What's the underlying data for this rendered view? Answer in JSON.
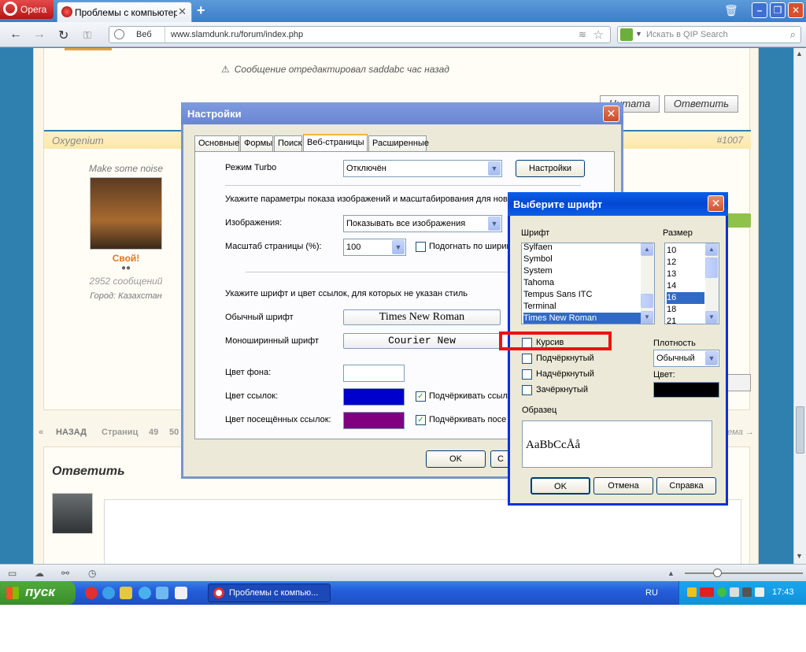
{
  "browser": {
    "menu_label": "Opera",
    "tab_title": "Проблемы с компьютер...",
    "tab_close": "✕",
    "new_tab": "+",
    "web_label": "Веб",
    "url": "www.slamdunk.ru/forum/index.php",
    "search_placeholder": "Искать в QIP Search"
  },
  "forum": {
    "edited_note": "Сообщение отредактировал saddabc час назад",
    "quote_button": "Цитата",
    "reply_button": "Ответить",
    "post_username": "Oxygenium",
    "post_number": "#1007",
    "user_motto": "Make some noise",
    "user_rank": "Свой!",
    "user_posts": "2952 сообщений",
    "user_city": "Город: Казахстан",
    "pager": {
      "prev": "«",
      "back": "НАЗАД",
      "pages_label": "Страниц",
      "page_a": "49",
      "page_b": "50",
      "next_topic": "тема →"
    },
    "reply_title": "Ответить"
  },
  "settings_dialog": {
    "title": "Настройки",
    "tabs": [
      "Основные",
      "Формы",
      "Поиск",
      "Веб-страницы",
      "Расширенные"
    ],
    "active_tab": "Веб-страницы",
    "turbo_label": "Режим Turbo",
    "turbo_value": "Отключён",
    "turbo_button": "Настройки",
    "images_hint": "Укажите параметры показа изображений и масштабирования для нов",
    "images_label": "Изображения:",
    "images_value": "Показывать все изображения",
    "zoom_label": "Масштаб страницы (%):",
    "zoom_value": "100",
    "fit_width_label": "Подогнать по ширин",
    "font_hint": "Укажите шрифт и цвет ссылок, для которых не указан стиль",
    "normal_font_label": "Обычный шрифт",
    "normal_font_value": "Times New Roman",
    "mono_font_label": "Моноширинный шрифт",
    "mono_font_value": "Courier New",
    "bg_color_label": "Цвет фона:",
    "link_color_label": "Цвет ссылок:",
    "underline_links_label": "Подчёркивать ссылк",
    "visited_color_label": "Цвет посещённых ссылок:",
    "underline_visited_label": "Подчёркивать посе",
    "ok_label": "OK",
    "cancel_partial": "С"
  },
  "font_dialog": {
    "title": "Выберите шрифт",
    "font_label": "Шрифт",
    "size_label": "Размер",
    "fonts": [
      "Sylfaen",
      "Symbol",
      "System",
      "Tahoma",
      "Tempus Sans ITC",
      "Terminal",
      "Times New Roman"
    ],
    "selected_font": "Times New Roman",
    "sizes": [
      "10",
      "12",
      "13",
      "14",
      "16",
      "18",
      "21"
    ],
    "selected_size": "16",
    "italic_label": "Курсив",
    "underline_label": "Подчёркнутый",
    "overline_label": "Надчёркнутый",
    "strikeout_label": "Зачёркнутый",
    "weight_label": "Плотность",
    "weight_value": "Обычный",
    "color_label": "Цвет:",
    "sample_label": "Образец",
    "sample_text": "AaBbCcÅå",
    "ok_label": "OK",
    "cancel_label": "Отмена",
    "help_label": "Справка"
  },
  "taskbar": {
    "start_label": "пуск",
    "task_label": "Проблемы с компью...",
    "lang": "RU",
    "clock": "17:43"
  },
  "colors": {
    "link_color": "#0000cc",
    "visited_color": "#800080",
    "bg_color": "#ffffff",
    "font_color": "#000000",
    "highlight": "#ee1111"
  }
}
